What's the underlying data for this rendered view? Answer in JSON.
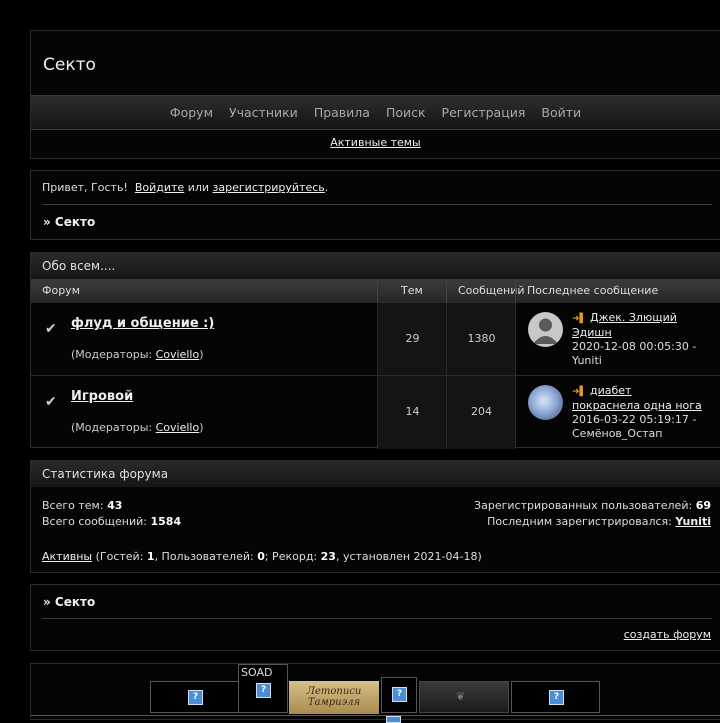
{
  "site": {
    "title": "Секто"
  },
  "nav": {
    "items": [
      "Форум",
      "Участники",
      "Правила",
      "Поиск",
      "Регистрация",
      "Войти"
    ],
    "active_topics": "Активные темы"
  },
  "welcome": {
    "greeting": "Привет, Гость!",
    "login": "Войдите",
    "or": "или",
    "register": "зарегистрируйтесь",
    "period": "."
  },
  "breadcrumb": "» Секто",
  "category": {
    "title": "Обо всем....",
    "headers": {
      "forum": "Форум",
      "topics": "Тем",
      "posts": "Сообщений",
      "last": "Последнее сообщение"
    },
    "forums": [
      {
        "name": "флуд и общение :)",
        "mods_prefix": "(Модераторы: ",
        "mod": "Coviello",
        "mods_suffix": ")",
        "topics": "29",
        "posts": "1380",
        "last_title": "Джек. Злющий Эдишн",
        "last_meta": "2020-12-08 00:05:30 - Yuniti",
        "avatar": "default-avatar-icon"
      },
      {
        "name": "Игровой",
        "mods_prefix": "(Модераторы: ",
        "mod": "Coviello",
        "mods_suffix": ")",
        "topics": "14",
        "posts": "204",
        "last_title": "диабет покраснела одна нога",
        "last_meta": "2016-03-22 05:19:17 - Семёнов_Остап",
        "avatar": "user-photo-avatar"
      }
    ]
  },
  "stats": {
    "title": "Статистика форума",
    "topics_label": "Всего тем:",
    "topics_value": "43",
    "posts_label": "Всего сообщений:",
    "posts_value": "1584",
    "users_label": "Зарегистрированных пользователей:",
    "users_value": "69",
    "last_reg_label": "Последним зарегистрировался:",
    "last_reg_value": "Yuniti",
    "active_link": "Активны",
    "guests_label": " (Гостей: ",
    "guests_value": "1",
    "members_label": ", Пользователей: ",
    "members_value": "0",
    "record_label": "; Рекорд: ",
    "record_value": "23",
    "record_date": ", установлен 2021-04-18)"
  },
  "footer": {
    "breadcrumb": "» Секто",
    "create_forum": "создать форум"
  },
  "banners": {
    "soad_label": "SOAD",
    "chronicles_line1": "Летописи",
    "chronicles_line2": "Тамриэля"
  },
  "colors": {
    "background": "#000000",
    "panel": "#050505",
    "header_gradient_top": "#2e2e2e",
    "last_post_icon": "#e09a2a"
  }
}
